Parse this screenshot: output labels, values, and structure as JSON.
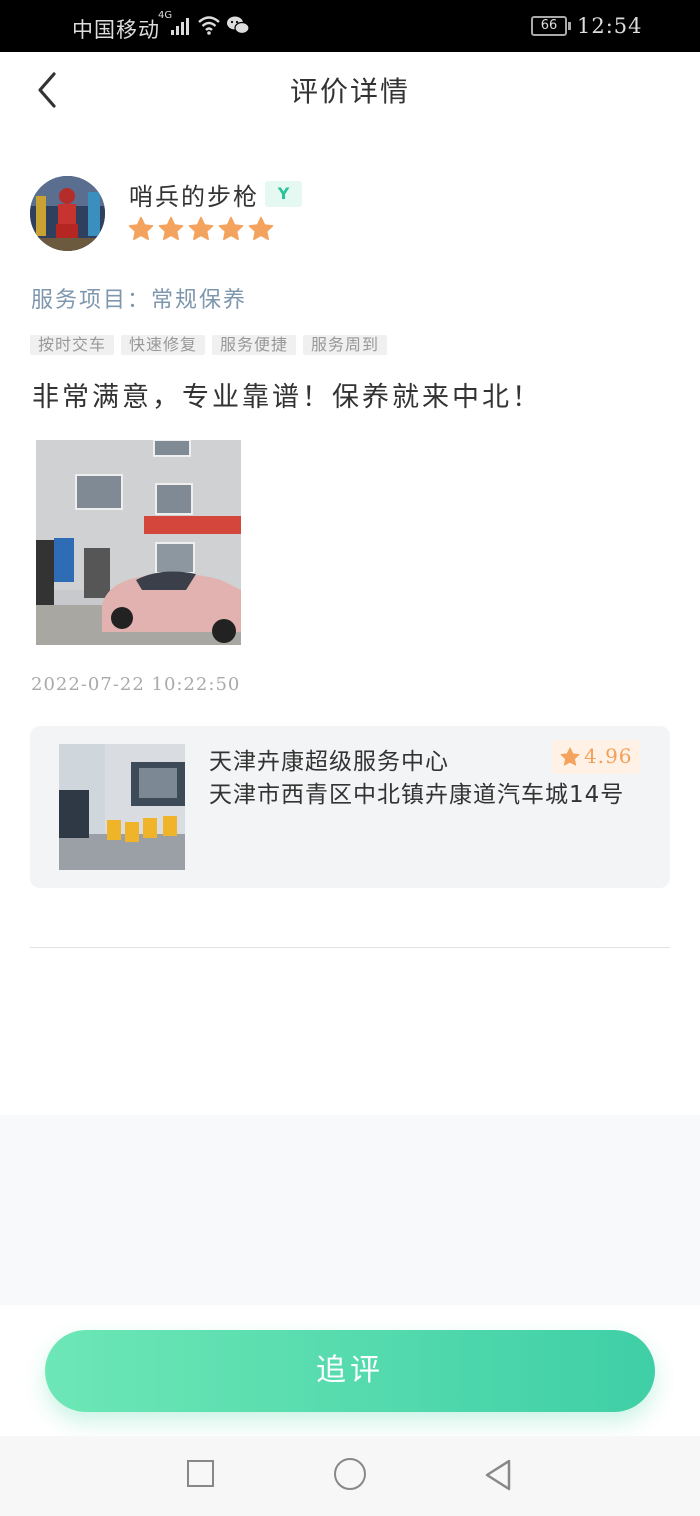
{
  "status_bar": {
    "carrier": "中国移动",
    "network": "4G",
    "battery": "66",
    "time": "12:54"
  },
  "header": {
    "title": "评价详情"
  },
  "review": {
    "username": "哨兵的步枪",
    "badge": "Y",
    "rating_stars": 5,
    "service_label": "服务项目：常规保养",
    "tags": [
      "按时交车",
      "快速修复",
      "服务便捷",
      "服务周到"
    ],
    "content": "非常满意，专业靠谱！保养就来中北！",
    "datetime": "2022-07-22 10:22:50"
  },
  "shop": {
    "name": "天津卉康超级服务中心",
    "rating": "4.96",
    "address": "天津市西青区中北镇卉康道汽车城14号"
  },
  "actions": {
    "followup_label": "追评"
  },
  "colors": {
    "accent": "#3fcfa6",
    "star": "#f4a35e",
    "service_text": "#7e97ad"
  }
}
